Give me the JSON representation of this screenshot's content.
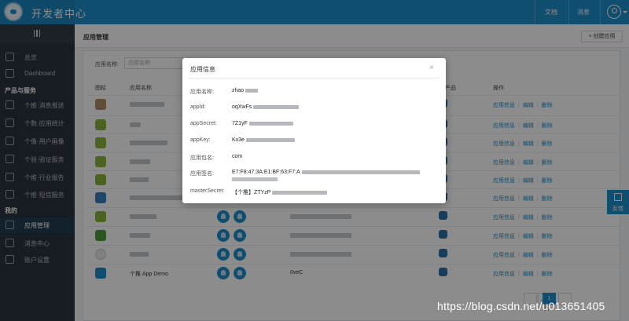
{
  "header": {
    "app_title": "开发者中心",
    "links": [
      "文档",
      "消息"
    ]
  },
  "sidebar": {
    "items_top": [
      {
        "label": "总览",
        "icon": "home-icon"
      },
      {
        "label": "Dashboard",
        "icon": "dashboard-icon"
      }
    ],
    "section_products": "产品与服务",
    "products": [
      {
        "label": "个推·消息推送",
        "icon": "push-icon"
      },
      {
        "label": "个数·应用统计",
        "icon": "eye-icon"
      },
      {
        "label": "个像·用户画像",
        "icon": "profile-icon"
      },
      {
        "label": "个验·验证服务",
        "icon": "verify-icon"
      },
      {
        "label": "个推·行业报告",
        "icon": "report-icon"
      },
      {
        "label": "个推·短信服务",
        "icon": "sms-icon"
      }
    ],
    "section_mine": "我的",
    "mine": [
      {
        "label": "应用管理",
        "icon": "grid-icon",
        "active": true
      },
      {
        "label": "消息中心",
        "icon": "mail-icon"
      },
      {
        "label": "账户设置",
        "icon": "settings-icon"
      }
    ]
  },
  "page": {
    "title": "应用管理",
    "create_button": "+ 创建应用",
    "filter_label": "应用名称:",
    "filter_placeholder": "应用名称"
  },
  "table": {
    "headers": {
      "icon": "图标",
      "name": "应用名称",
      "product": "产品",
      "actions": "操作"
    },
    "action_labels": [
      "应用信息",
      "编辑",
      "删除"
    ],
    "last_row_name": "个推 App Demo",
    "last_row_appid": "0veC"
  },
  "pagination": {
    "prev": "上一页",
    "current": "1"
  },
  "feedback": {
    "label": "反馈"
  },
  "modal": {
    "title": "应用信息",
    "close": "×",
    "fields": [
      {
        "label": "应用名称:",
        "value": "zhao"
      },
      {
        "label": "appId:",
        "value": "oqXwFs"
      },
      {
        "label": "appSecret:",
        "value": "7Z1yF"
      },
      {
        "label": "appKey:",
        "value": "Kx3e"
      },
      {
        "label": "应用包名:",
        "value": "com"
      },
      {
        "label": "应用签名:",
        "value": "E7:F8:47:3A:E1:BF:63:F7:A"
      },
      {
        "label": "masterSecret:",
        "value": "【个推】ZTYzP"
      }
    ]
  },
  "watermark": "https://blog.csdn.net/u013651405",
  "colors": {
    "primary": "#1d8ecb",
    "sidebar": "#2b3440",
    "link": "#1d8ecb"
  }
}
